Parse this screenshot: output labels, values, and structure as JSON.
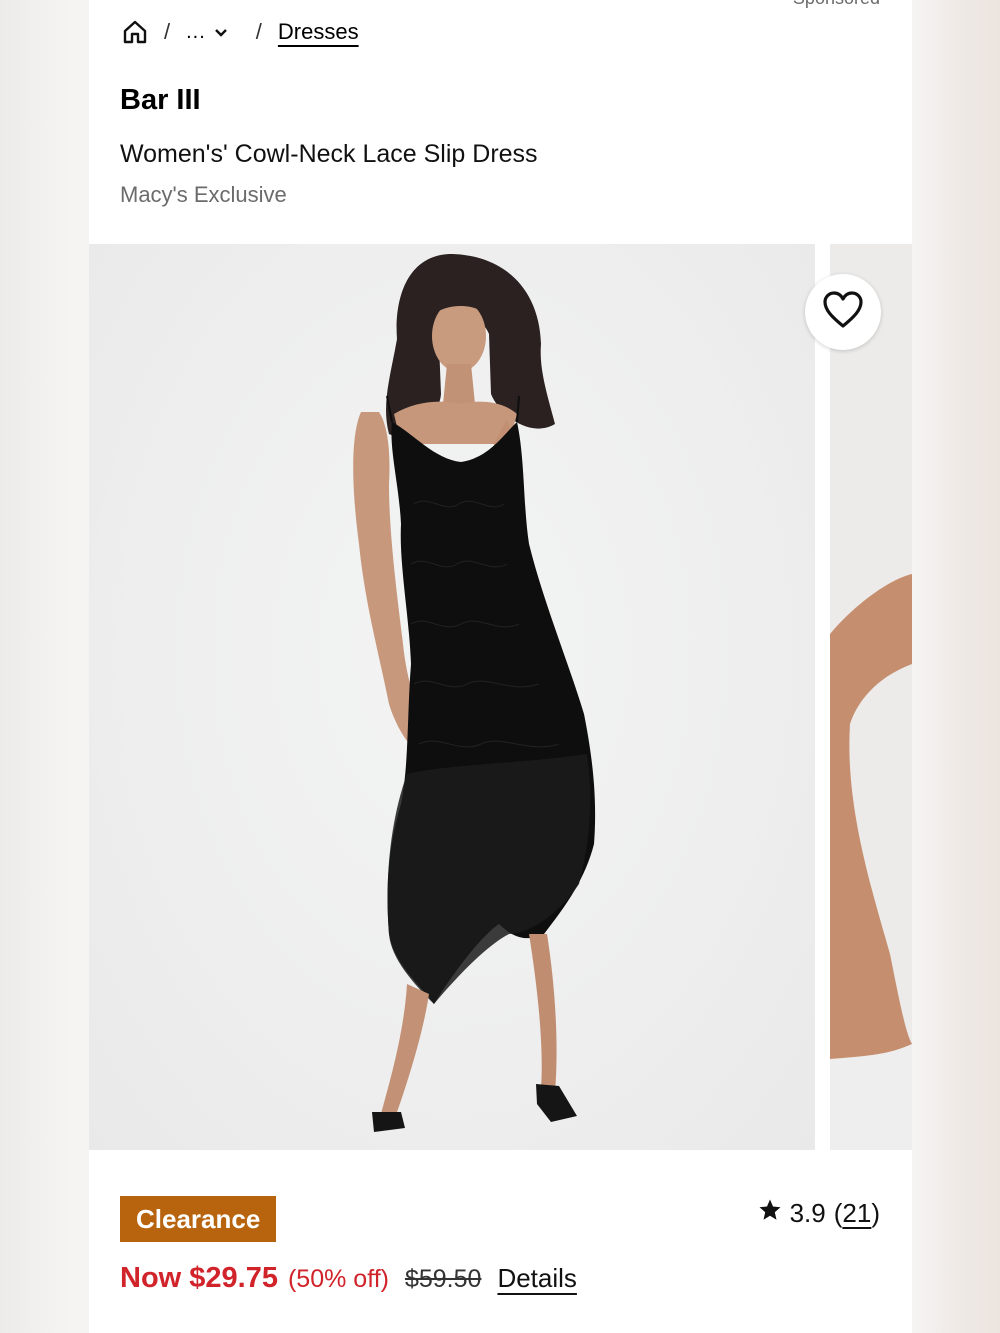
{
  "header": {
    "sponsored_label": "Sponsored"
  },
  "breadcrumb": {
    "home_icon": "home-icon",
    "separator": "/",
    "ellipsis_label": "...",
    "chevron_icon": "chevron-down-icon",
    "current": "Dresses"
  },
  "product": {
    "brand": "Bar III",
    "title": "Women's' Cowl-Neck Lace Slip Dress",
    "exclusive": "Macy's Exclusive",
    "favorite_icon": "heart-icon",
    "image_alt": "Model wearing black cowl-neck lace slip dress"
  },
  "pricing": {
    "badge": "Clearance",
    "now_price": "Now $29.75",
    "discount": "(50% off)",
    "original_price": "$59.50",
    "details_link": "Details"
  },
  "rating": {
    "star_icon": "star-icon",
    "value": "3.9",
    "open_paren": "(",
    "count": "21",
    "close_paren": ")"
  },
  "colors": {
    "clearance_badge": "#b8640f",
    "sale_red": "#d1232a"
  }
}
